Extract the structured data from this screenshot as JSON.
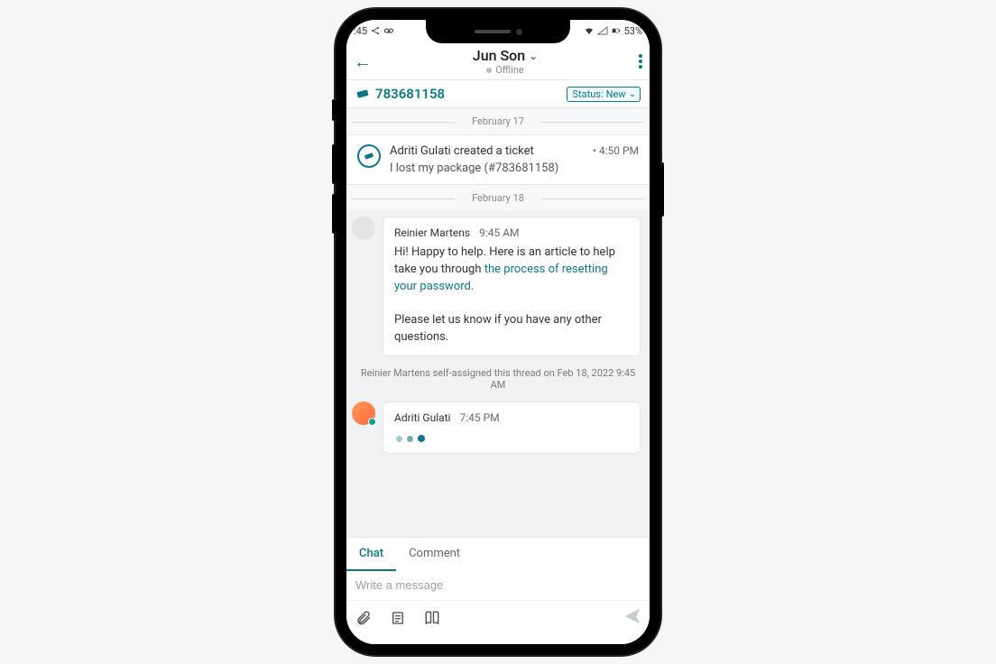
{
  "statusBar": {
    "time": ":45",
    "battery": "53%"
  },
  "header": {
    "title": "Jun Son",
    "subtitle": "Offline"
  },
  "ticket": {
    "id": "783681158",
    "statusLabel": "Status:",
    "statusValue": "New"
  },
  "dates": {
    "d1": "February 17",
    "d2": "February 18"
  },
  "ticketEvent": {
    "actor": "Adriti Gulati created a ticket",
    "time": "• 4:50 PM",
    "subject": "I lost my package (#783681158)"
  },
  "msg1": {
    "name": "Reinier Martens",
    "time": "9:45 AM",
    "text1": "Hi! Happy to help. Here is an article to help take you through ",
    "link": "the process of resetting your password",
    "text2": ".",
    "text3": "Please let us know if you have any other questions."
  },
  "sysNote": "Reinier Martens self-assigned this thread on Feb 18, 2022 9:45 AM",
  "msg2": {
    "name": "Adriti Gulati",
    "time": "7:45 PM"
  },
  "composer": {
    "tabChat": "Chat",
    "tabComment": "Comment",
    "placeholder": "Write a message"
  }
}
